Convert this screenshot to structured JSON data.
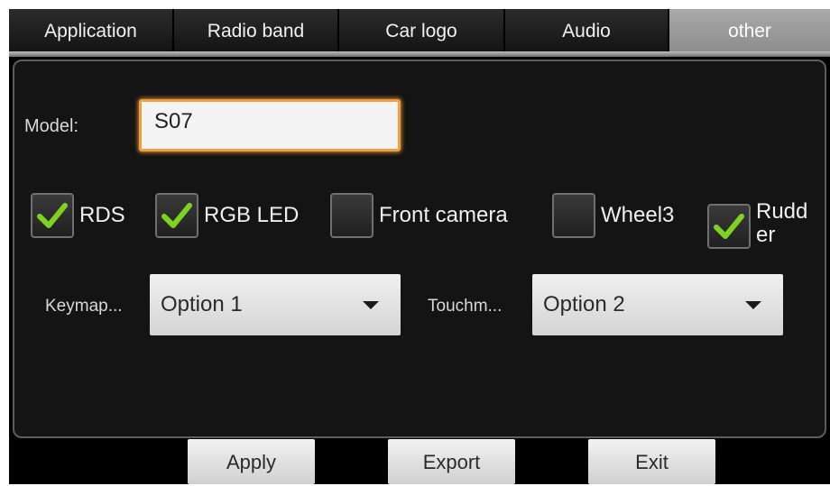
{
  "tabs": [
    {
      "label": "Application",
      "active": false
    },
    {
      "label": "Radio band",
      "active": false
    },
    {
      "label": "Car logo",
      "active": false
    },
    {
      "label": "Audio",
      "active": false
    },
    {
      "label": "other",
      "active": true
    }
  ],
  "model": {
    "label": "Model:",
    "value": "S07"
  },
  "checkboxes": [
    {
      "label": "RDS",
      "checked": true,
      "icon": "checkmark-icon"
    },
    {
      "label": "RGB LED",
      "checked": true,
      "icon": "checkmark-icon"
    },
    {
      "label": "Front camera",
      "checked": false
    },
    {
      "label": "Wheel3",
      "checked": false
    },
    {
      "label": "Rudder",
      "label_line1": "Rudd",
      "label_line2": "er",
      "checked": true,
      "icon": "checkmark-icon"
    }
  ],
  "keymap": {
    "label": "Keymap...",
    "selected": "Option 1",
    "icon": "dropdown-arrow-icon"
  },
  "touchmap": {
    "label": "Touchm...",
    "selected": "Option 2",
    "icon": "dropdown-arrow-icon"
  },
  "buttons": {
    "apply": "Apply",
    "export": "Export",
    "exit": "Exit"
  },
  "colors": {
    "accent_focus": "#f0a040",
    "check_green": "#7ed321",
    "active_tab": "#9a9a9a"
  }
}
